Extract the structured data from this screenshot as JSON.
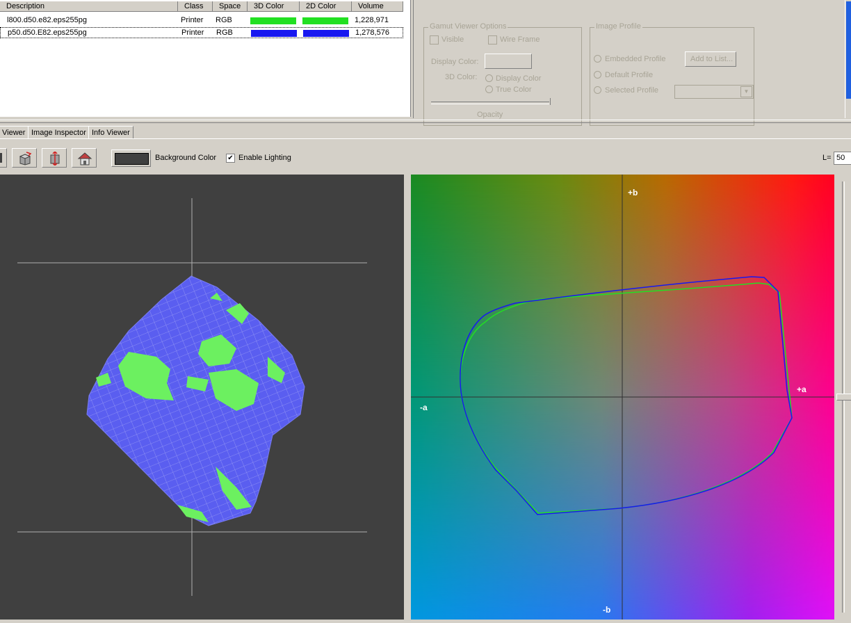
{
  "table": {
    "headers": [
      "Description",
      "Class",
      "Space",
      "3D Color",
      "2D Color",
      "Volume"
    ],
    "rows": [
      {
        "description": "l800.d50.e82.eps255pg",
        "class": "Printer",
        "space": "RGB",
        "color3d": "#22e022",
        "color2d": "#22e022",
        "volume": "1,228,971"
      },
      {
        "description": "p50.d50.E82.eps255pg",
        "class": "Printer",
        "space": "RGB",
        "color3d": "#1818f0",
        "color2d": "#1818f0",
        "volume": "1,278,576"
      }
    ]
  },
  "gamut_options": {
    "title": "Gamut Viewer Options",
    "visible": "Visible",
    "wire_frame": "Wire Frame",
    "display_color": "Display Color:",
    "color3d": "3D Color:",
    "radio_display": "Display Color",
    "radio_true": "True Color",
    "opacity": "Opacity"
  },
  "image_profile": {
    "title": "Image Profile",
    "embedded": "Embedded Profile",
    "default": "Default Profile",
    "selected": "Selected Profile",
    "add_button": "Add to List..."
  },
  "tabs": [
    "Viewer",
    "Image Inspector",
    "Info Viewer"
  ],
  "toolbar": {
    "background_color_label": "Background Color",
    "background_color": "#404040",
    "enable_lighting": "Enable Lighting",
    "check_mark": "✔",
    "l_label": "L=",
    "l_value": "50"
  },
  "view2d": {
    "plus_b": "+b",
    "minus_b": "-b",
    "plus_a": "+a",
    "minus_a": "-a"
  },
  "colors": {
    "gamut_green": "#22e022",
    "gamut_blue": "#1818f0",
    "wire_blue": "#5a5ef0",
    "wire_green": "#6cf060"
  }
}
